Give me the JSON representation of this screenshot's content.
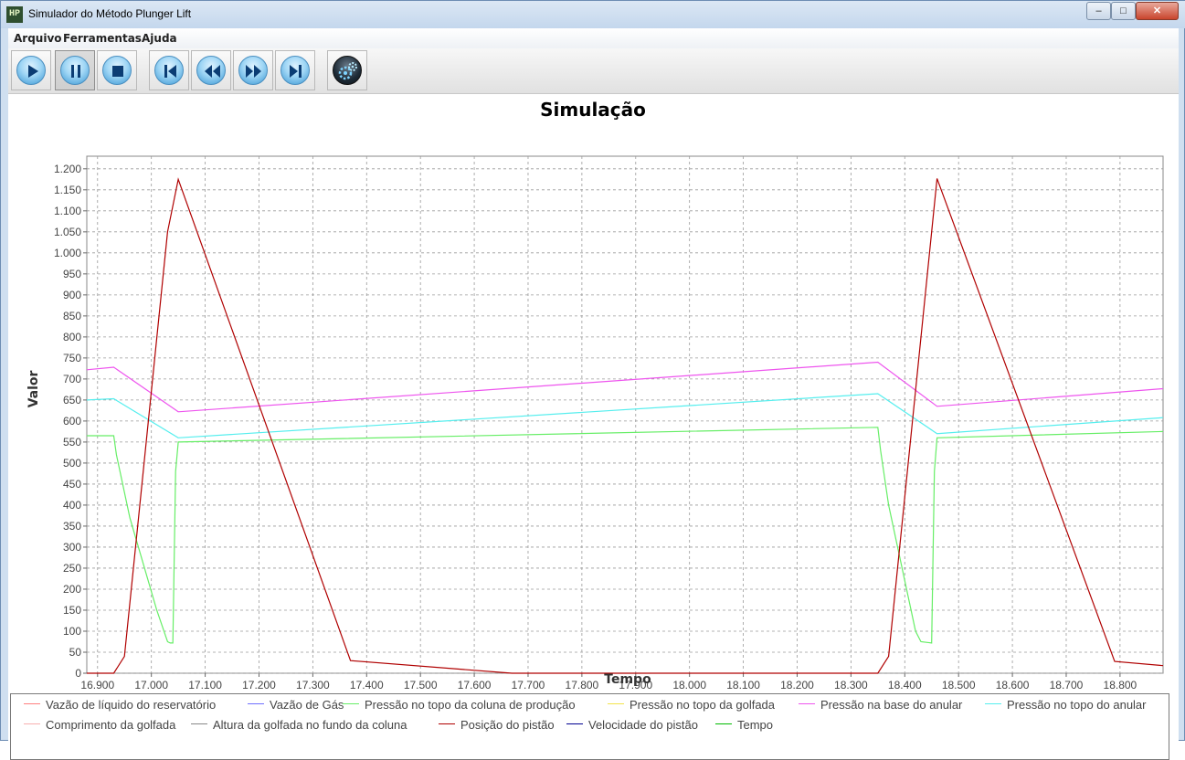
{
  "window": {
    "title": "Simulador do Método Plunger Lift",
    "icon": "app-logo-icon",
    "controls": [
      "minimize-icon",
      "maximize-icon",
      "close-icon"
    ]
  },
  "menu": [
    "Arquivo",
    "Ferramentas",
    "Ajuda"
  ],
  "toolbar": {
    "buttons": [
      {
        "name": "play-button",
        "icon": "play-icon"
      },
      {
        "name": "pause-button",
        "icon": "pause-icon",
        "pressed": true
      },
      {
        "name": "stop-button",
        "icon": "stop-icon"
      },
      {
        "name": "skip-start-button",
        "icon": "skip-start-icon"
      },
      {
        "name": "rewind-button",
        "icon": "rewind-icon"
      },
      {
        "name": "fast-forward-button",
        "icon": "fast-forward-icon"
      },
      {
        "name": "skip-end-button",
        "icon": "skip-end-icon"
      },
      {
        "name": "settings-button",
        "icon": "gears-icon"
      }
    ]
  },
  "chart_data": {
    "type": "line",
    "title": "Simulação",
    "xlabel": "Tempo",
    "ylabel": "Valor",
    "xlim": [
      16.88,
      18.88
    ],
    "ylim": [
      0,
      1230
    ],
    "xticks": [
      "16.900",
      "17.000",
      "17.100",
      "17.200",
      "17.300",
      "17.400",
      "17.500",
      "17.600",
      "17.700",
      "17.800",
      "17.900",
      "18.000",
      "18.100",
      "18.200",
      "18.300",
      "18.400",
      "18.500",
      "18.600",
      "18.700",
      "18.800"
    ],
    "yticks": [
      "0",
      "50",
      "100",
      "150",
      "200",
      "250",
      "300",
      "350",
      "400",
      "450",
      "500",
      "550",
      "600",
      "650",
      "700",
      "750",
      "800",
      "850",
      "900",
      "950",
      "1.000",
      "1.050",
      "1.100",
      "1.150",
      "1.200"
    ],
    "grid": true,
    "legend_position": "bottom",
    "legend": [
      {
        "name": "Vazão de líquido do reservatório",
        "color": "#ff7f7f"
      },
      {
        "name": "Vazão de Gás",
        "color": "#7070ff"
      },
      {
        "name": "Pressão no topo da coluna de produção",
        "color": "#66ee66"
      },
      {
        "name": "Pressão no topo da golfada",
        "color": "#f2e34a"
      },
      {
        "name": "Pressão na base do anular",
        "color": "#ee55ee"
      },
      {
        "name": "Pressão no topo do anular",
        "color": "#55eeee"
      },
      {
        "name": "Comprimento da golfada",
        "color": "#f7b0b0"
      },
      {
        "name": "Altura da golfada no fundo da coluna",
        "color": "#888888"
      },
      {
        "name": "Posição do pistão",
        "color": "#b00000"
      },
      {
        "name": "Velocidade do pistão",
        "color": "#000090"
      },
      {
        "name": "Tempo",
        "color": "#00bb00"
      }
    ],
    "series": [
      {
        "name": "Pressão na base do anular",
        "color": "#ee55ee",
        "x": [
          16.88,
          16.93,
          17.05,
          18.35,
          18.46,
          18.88
        ],
        "y": [
          722,
          728,
          622,
          740,
          635,
          677
        ]
      },
      {
        "name": "Pressão no topo do anular",
        "color": "#55eeee",
        "x": [
          16.88,
          16.93,
          17.05,
          18.35,
          18.46,
          18.88
        ],
        "y": [
          650,
          653,
          560,
          665,
          570,
          608
        ]
      },
      {
        "name": "Pressão no topo da coluna de produção",
        "color": "#66ee66",
        "x": [
          16.88,
          16.93,
          16.935,
          16.96,
          17.01,
          17.03,
          17.035,
          17.04,
          17.045,
          17.05,
          18.35,
          18.355,
          18.37,
          18.42,
          18.43,
          18.45,
          18.455,
          18.46,
          18.88
        ],
        "y": [
          565,
          565,
          520,
          370,
          150,
          75,
          72,
          72,
          480,
          550,
          585,
          530,
          400,
          100,
          75,
          72,
          480,
          560,
          575
        ]
      },
      {
        "name": "Posição do pistão",
        "color": "#b00000",
        "x": [
          16.88,
          16.93,
          16.95,
          17.03,
          17.05,
          17.37,
          17.67,
          18.35,
          18.37,
          18.45,
          18.46,
          18.79,
          18.88
        ],
        "y": [
          0,
          0,
          40,
          1050,
          1175,
          30,
          0,
          0,
          40,
          1050,
          1177,
          28,
          18
        ]
      }
    ]
  }
}
